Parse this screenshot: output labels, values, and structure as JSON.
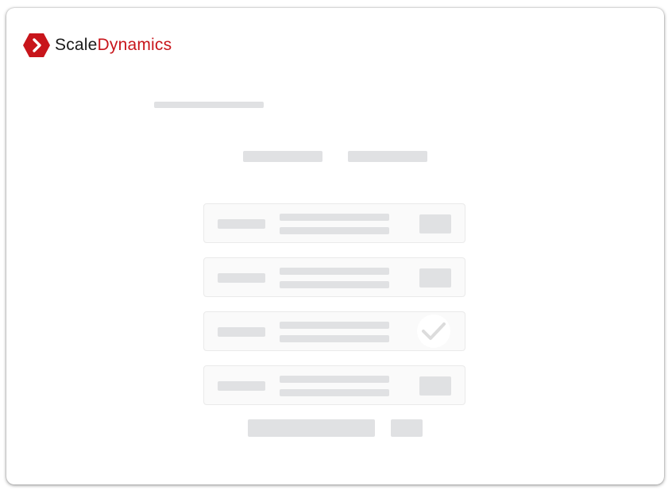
{
  "brand": {
    "name_part1": "Scale",
    "name_part2": "Dynamics",
    "icon": "chevron-right-hexagon-icon",
    "colors": {
      "primary": "#c8151b",
      "dark": "#1a1a1a"
    }
  },
  "skeleton": {
    "placeholder_color": "#e0e1e3",
    "card_background": "#fafafa",
    "cards": [
      {
        "state": "pending"
      },
      {
        "state": "pending"
      },
      {
        "state": "done",
        "icon": "checkmark-icon"
      },
      {
        "state": "pending"
      }
    ]
  }
}
